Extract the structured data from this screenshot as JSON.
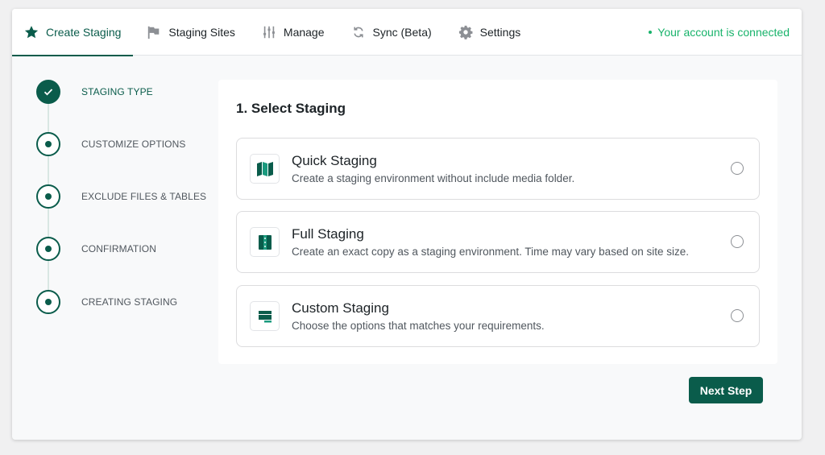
{
  "nav": {
    "tabs": [
      {
        "label": "Create Staging",
        "icon": "star-icon",
        "active": true
      },
      {
        "label": "Staging Sites",
        "icon": "flag-icon",
        "active": false
      },
      {
        "label": "Manage",
        "icon": "sliders-icon",
        "active": false
      },
      {
        "label": "Sync (Beta)",
        "icon": "sync-icon",
        "active": false
      },
      {
        "label": "Settings",
        "icon": "gear-icon",
        "active": false
      }
    ],
    "status": "Your account is connected"
  },
  "steps": [
    {
      "label": "STAGING TYPE",
      "state": "done"
    },
    {
      "label": "CUSTOMIZE OPTIONS",
      "state": "pending"
    },
    {
      "label": "EXCLUDE FILES & TABLES",
      "state": "pending"
    },
    {
      "label": "CONFIRMATION",
      "state": "pending"
    },
    {
      "label": "CREATING STAGING",
      "state": "pending"
    }
  ],
  "main": {
    "title": "1. Select Staging",
    "options": [
      {
        "title": "Quick Staging",
        "description": "Create a staging environment without include media folder.",
        "icon": "map-icon"
      },
      {
        "title": "Full Staging",
        "description": "Create an exact copy as a staging environment. Time may vary based on site size.",
        "icon": "book-icon"
      },
      {
        "title": "Custom Staging",
        "description": "Choose the options that matches your requirements.",
        "icon": "window-icon"
      }
    ],
    "next_label": "Next Step"
  },
  "colors": {
    "accent": "#0a5c4b",
    "status_green": "#18b36b",
    "icon_teal": "#1a9a7e"
  }
}
